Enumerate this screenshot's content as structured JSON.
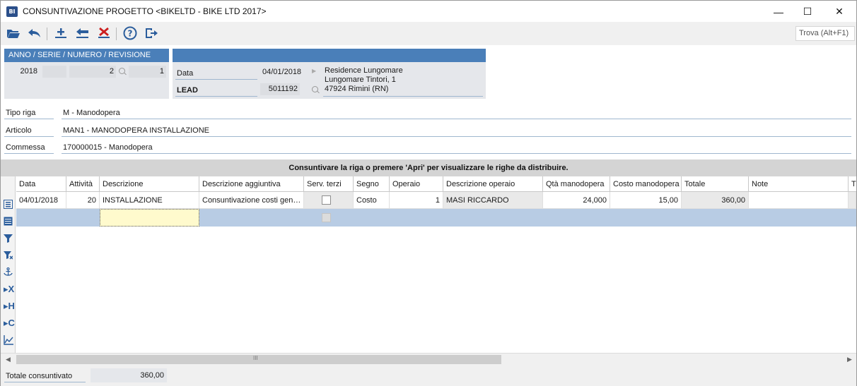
{
  "window": {
    "title": "CONSUNTIVAZIONE PROGETTO <BIKELTD - BIKE LTD 2017>",
    "app_icon_text": "BI",
    "minimize_glyph": "—",
    "maximize_glyph": "☐",
    "close_glyph": "✕"
  },
  "toolbar": {
    "icons": [
      "open-folder-icon",
      "undo-icon",
      "add-row-icon",
      "return-icon",
      "delete-icon",
      "help-icon",
      "exit-icon"
    ],
    "find_placeholder": "Trova (Alt+F1)"
  },
  "header_group": {
    "title": "ANNO / SERIE / NUMERO / REVISIONE",
    "anno": "2018",
    "serie": "",
    "numero": "2",
    "revisione": "1"
  },
  "doc_group": {
    "data_label": "Data",
    "data_value": "04/01/2018",
    "lead_label": "LEAD",
    "lead_value": "5011192",
    "address_line1": "Residence Lungomare",
    "address_line2": "Lungomare Tintori, 1",
    "address_line3": "47924 Rimini (RN)"
  },
  "fields": {
    "tipo_riga_label": "Tipo riga",
    "tipo_riga_value": "M - Manodopera",
    "articolo_label": "Articolo",
    "articolo_value": "MAN1 - MANODOPERA INSTALLAZIONE",
    "commessa_label": "Commessa",
    "commessa_value": "170000015 - Manodopera"
  },
  "banner": "Consuntivare la riga o premere 'Apri' per visualizzare le righe da distribuire.",
  "grid": {
    "headers": [
      "Data",
      "Attività",
      "Descrizione",
      "Descrizione aggiuntiva",
      "Serv. terzi",
      "Segno",
      "Operaio",
      "Descrizione operaio",
      "Qtà manodopera",
      "Costo manodopera",
      "Totale",
      "Note",
      "Ti"
    ],
    "row1": {
      "data": "04/01/2018",
      "attivita": "20",
      "descrizione": "INSTALLAZIONE",
      "descrizione_aggiuntiva": "Consuntivazione costi gen…",
      "serv_terzi": false,
      "segno": "Costo",
      "operaio": "1",
      "descrizione_operaio": "MASI RICCARDO",
      "qta_manodopera": "24,000",
      "costo_manodopera": "15,00",
      "totale": "360,00",
      "note": ""
    },
    "left_icons": [
      "list-icon",
      "table-icon",
      "filter-icon",
      "filter-clear-icon",
      "anchor-icon",
      "column-x-icon",
      "column-h-icon",
      "column-c-icon",
      "chart-icon"
    ],
    "scroll_thumb_glyph": "III",
    "scroll_left_glyph": "◀",
    "scroll_right_glyph": "▶"
  },
  "footer": {
    "totale_label": "Totale consuntivato",
    "totale_value": "360,00"
  },
  "colors": {
    "group_header": "#4a7fb9",
    "group_body": "#e5e7eb",
    "selected_row": "#b8cce4",
    "active_cell": "#fffacd",
    "banner": "#d4d4d4"
  }
}
